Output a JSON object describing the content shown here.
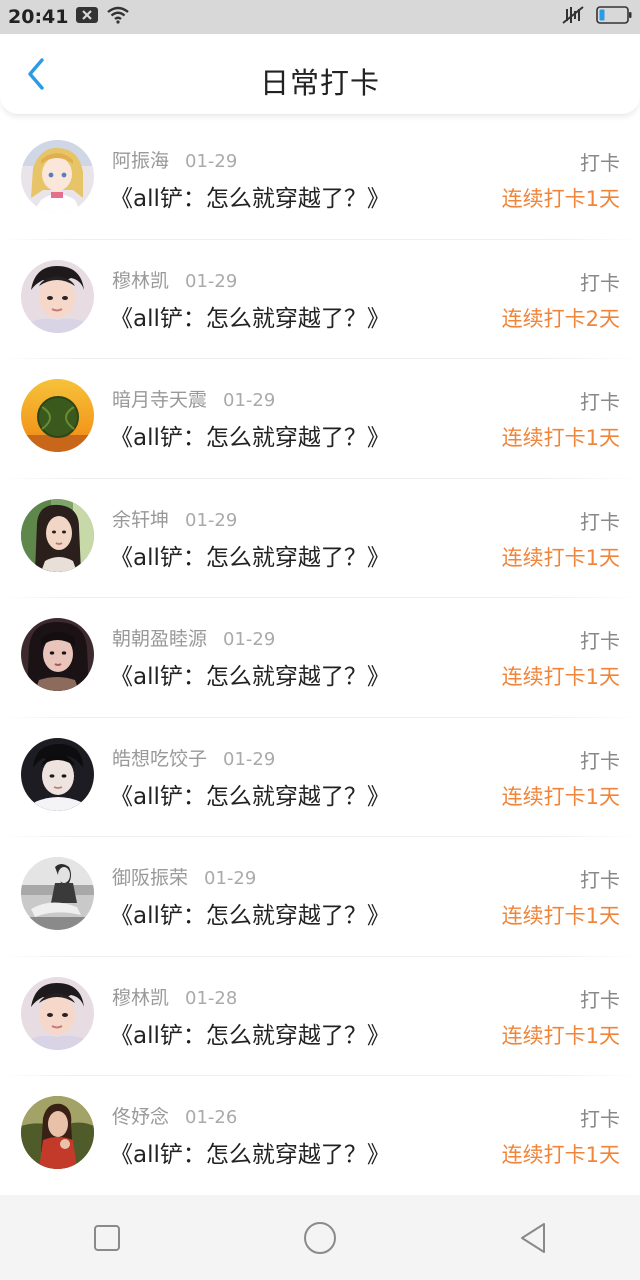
{
  "status_bar": {
    "time": "20:41",
    "icons": [
      "notification-close-icon",
      "wifi-icon",
      "mute-icon",
      "battery-icon"
    ]
  },
  "header": {
    "title": "日常打卡",
    "back_icon": "chevron-left-icon",
    "accent_color": "#2a9be5"
  },
  "list": [
    {
      "name": "阿振海",
      "date": "01-29",
      "book": "《all铲：怎么就穿越了？》",
      "action": "打卡",
      "streak": "连续打卡1天",
      "avatar": "anime-girl-avatar"
    },
    {
      "name": "穆林凯",
      "date": "01-29",
      "book": "《all铲：怎么就穿越了？》",
      "action": "打卡",
      "streak": "连续打卡2天",
      "avatar": "boy-portrait-avatar"
    },
    {
      "name": "暗月寺天震",
      "date": "01-29",
      "book": "《all铲：怎么就穿越了？》",
      "action": "打卡",
      "streak": "连续打卡1天",
      "avatar": "tennis-ball-avatar"
    },
    {
      "name": "余轩坤",
      "date": "01-29",
      "book": "《all铲：怎么就穿越了？》",
      "action": "打卡",
      "streak": "连续打卡1天",
      "avatar": "girl-portrait-avatar"
    },
    {
      "name": "朝朝盈睦源",
      "date": "01-29",
      "book": "《all铲：怎么就穿越了？》",
      "action": "打卡",
      "streak": "连续打卡1天",
      "avatar": "girl-dark-hair-avatar"
    },
    {
      "name": "皓想吃饺子",
      "date": "01-29",
      "book": "《all铲：怎么就穿越了？》",
      "action": "打卡",
      "streak": "连续打卡1天",
      "avatar": "boy-dark-avatar"
    },
    {
      "name": "御阪振荣",
      "date": "01-29",
      "book": "《all铲：怎么就穿越了？》",
      "action": "打卡",
      "streak": "连续打卡1天",
      "avatar": "grayscale-photo-avatar"
    },
    {
      "name": "穆林凯",
      "date": "01-28",
      "book": "《all铲：怎么就穿越了？》",
      "action": "打卡",
      "streak": "连续打卡1天",
      "avatar": "boy-portrait-avatar"
    },
    {
      "name": "佟妤念",
      "date": "01-26",
      "book": "《all铲：怎么就穿越了？》",
      "action": "打卡",
      "streak": "连续打卡1天",
      "avatar": "girl-nature-avatar"
    }
  ],
  "colors": {
    "streak": "#f0853a",
    "name": "#999999",
    "text": "#222222"
  },
  "nav_bar": {
    "buttons": [
      "recent-apps-icon",
      "home-icon",
      "back-triangle-icon"
    ]
  }
}
